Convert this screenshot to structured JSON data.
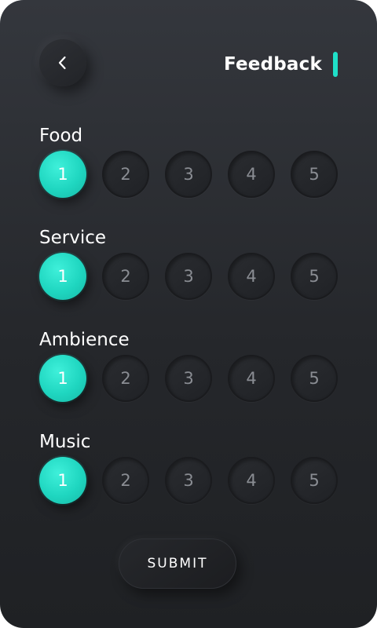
{
  "header": {
    "title": "Feedback",
    "back_icon": "chevron-left-icon"
  },
  "colors": {
    "accent": "#1fe0c8",
    "background": "#2a2c31",
    "text": "#ffffff",
    "muted_text": "#8a8d93"
  },
  "rating_options": [
    "1",
    "2",
    "3",
    "4",
    "5"
  ],
  "sections": [
    {
      "label": "Food",
      "selected": "1"
    },
    {
      "label": "Service",
      "selected": "1"
    },
    {
      "label": "Ambience",
      "selected": "1"
    },
    {
      "label": "Music",
      "selected": "1"
    }
  ],
  "submit": {
    "label": "SUBMIT"
  }
}
